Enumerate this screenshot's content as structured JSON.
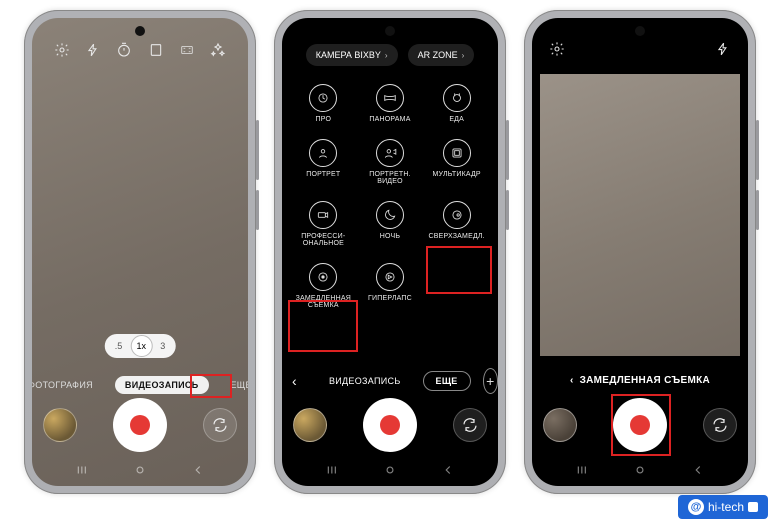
{
  "phone1": {
    "zoom": {
      "left": ".5",
      "center": "1x",
      "right": "3"
    },
    "modes": {
      "left": "ФОТОГРАФИЯ",
      "active": "ВИДЕОЗАПИСЬ",
      "right": "ЕЩЕ"
    }
  },
  "phone2": {
    "pills": {
      "bixby": "КАМЕРА BIXBY",
      "ar": "AR ZONE"
    },
    "grid": [
      {
        "label": "ПРО"
      },
      {
        "label": "ПАНОРАМА"
      },
      {
        "label": "ЕДА"
      },
      {
        "label": "ПОРТРЕТ"
      },
      {
        "label": "ПОРТРЕТН. ВИДЕО"
      },
      {
        "label": "МУЛЬТИКАДР"
      },
      {
        "label": "ПРОФЕССИ- ОНАЛЬНОЕ"
      },
      {
        "label": "НОЧЬ"
      },
      {
        "label": "СВЕРХЗАМЕДЛ."
      },
      {
        "label": "ЗАМЕДЛЕННАЯ СЪЕМКА"
      },
      {
        "label": "ГИПЕРЛАПС"
      }
    ],
    "modes": {
      "back": "‹",
      "video": "ВИДЕОЗАПИСЬ",
      "more": "ЕЩЕ"
    }
  },
  "phone3": {
    "back_label": "ЗАМЕДЛЕННАЯ СЪЕМКА"
  },
  "watermark": "hi-tech"
}
